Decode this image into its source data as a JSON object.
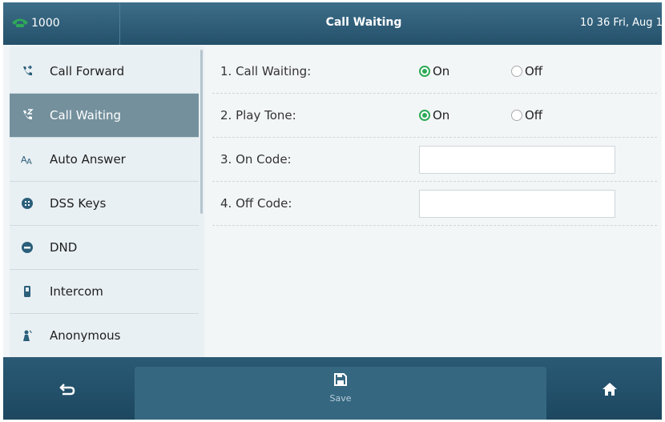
{
  "topbar": {
    "line": "1000",
    "title": "Call Waiting",
    "clock": "10 36 Fri, Aug 1"
  },
  "colors": {
    "accent_green": "#2eaa57",
    "sidebar_active": "#74909d",
    "bar_blue": "#245069"
  },
  "sidebar": {
    "items": [
      {
        "label": "Call Forward",
        "icon": "call-forward-icon"
      },
      {
        "label": "Call Waiting",
        "icon": "call-waiting-icon",
        "active": true
      },
      {
        "label": "Auto Answer",
        "icon": "auto-answer-icon"
      },
      {
        "label": "DSS Keys",
        "icon": "dss-keys-icon"
      },
      {
        "label": "DND",
        "icon": "dnd-icon"
      },
      {
        "label": "Intercom",
        "icon": "intercom-icon"
      },
      {
        "label": "Anonymous",
        "icon": "anonymous-icon"
      }
    ]
  },
  "form": {
    "call_waiting": {
      "label": "1. Call Waiting:",
      "on": "On",
      "off": "Off",
      "selected": "On"
    },
    "play_tone": {
      "label": "2. Play Tone:",
      "on": "On",
      "off": "Off",
      "selected": "On"
    },
    "on_code": {
      "label": "3. On Code:",
      "value": ""
    },
    "off_code": {
      "label": "4. Off Code:",
      "value": ""
    }
  },
  "bottombar": {
    "back_icon": "back-arrow-icon",
    "save_label": "Save",
    "save_icon": "save-icon",
    "home_icon": "home-icon"
  }
}
